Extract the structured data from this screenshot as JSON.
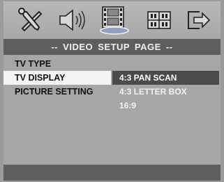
{
  "title": "-- VIDEO SETUP PAGE --",
  "toolbar": {
    "icons": [
      {
        "name": "general-setup-icon"
      },
      {
        "name": "audio-setup-icon"
      },
      {
        "name": "video-setup-icon",
        "active": true
      },
      {
        "name": "preferences-icon"
      },
      {
        "name": "exit-icon"
      }
    ]
  },
  "menu": {
    "items": [
      {
        "label": "TV TYPE"
      },
      {
        "label": "TV DISPLAY",
        "selected": true
      },
      {
        "label": "PICTURE SETTING"
      }
    ]
  },
  "submenu": {
    "options": [
      {
        "label": "4:3 PAN SCAN",
        "selected": true
      },
      {
        "label": "4:3 LETTER BOX"
      },
      {
        "label": "16:9"
      }
    ]
  },
  "colors": {
    "background": "#a7a5a7",
    "bar": "#5f5d5f",
    "highlight": "#f4f4f4",
    "option_highlight": "#4c4a4c"
  }
}
